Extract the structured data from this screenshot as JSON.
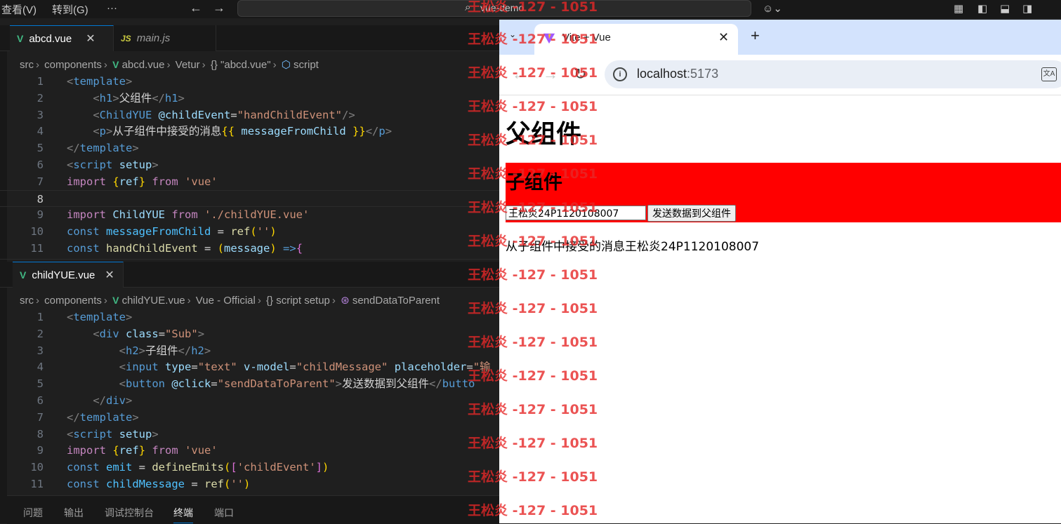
{
  "titlebar": {
    "menu": [
      "查看(V)",
      "转到(G)",
      "···"
    ],
    "command_center": "vue-demo"
  },
  "editor_top": {
    "tabs": [
      {
        "label": "abcd.vue",
        "icon": "vue-icon",
        "active": true
      },
      {
        "label": "main.js",
        "icon": "js-icon",
        "active": false
      }
    ],
    "breadcrumb": [
      "src",
      "components",
      "abcd.vue",
      "Vetur",
      "{} \"abcd.vue\"",
      "script"
    ],
    "current_line": 8,
    "lines": [
      {
        "n": "1",
        "tokens": [
          [
            "pt",
            "<"
          ],
          [
            "tg",
            "template"
          ],
          [
            "pt",
            ">"
          ]
        ]
      },
      {
        "n": "2",
        "tokens": [
          [
            "tx",
            "    "
          ],
          [
            "pt",
            "<"
          ],
          [
            "tg",
            "h1"
          ],
          [
            "pt",
            ">"
          ],
          [
            "tx",
            "父组件"
          ],
          [
            "pt",
            "</"
          ],
          [
            "tg",
            "h1"
          ],
          [
            "pt",
            ">"
          ]
        ]
      },
      {
        "n": "3",
        "tokens": [
          [
            "tx",
            "    "
          ],
          [
            "pt",
            "<"
          ],
          [
            "tg",
            "ChildYUE"
          ],
          [
            "tx",
            " "
          ],
          [
            "at",
            "@childEvent"
          ],
          [
            "tx",
            "="
          ],
          [
            "st",
            "\"handChildEvent\""
          ],
          [
            "pt",
            "/>"
          ]
        ]
      },
      {
        "n": "4",
        "tokens": [
          [
            "tx",
            "    "
          ],
          [
            "pt",
            "<"
          ],
          [
            "tg",
            "p"
          ],
          [
            "pt",
            ">"
          ],
          [
            "tx",
            "从子组件中接受的消息"
          ],
          [
            "br",
            "{{"
          ],
          [
            "tx",
            " "
          ],
          [
            "vr",
            "messageFromChild"
          ],
          [
            "tx",
            " "
          ],
          [
            "br",
            "}}"
          ],
          [
            "pt",
            "</"
          ],
          [
            "tg",
            "p"
          ],
          [
            "pt",
            ">"
          ]
        ]
      },
      {
        "n": "5",
        "tokens": [
          [
            "pt",
            "</"
          ],
          [
            "tg",
            "template"
          ],
          [
            "pt",
            ">"
          ]
        ]
      },
      {
        "n": "6",
        "tokens": [
          [
            "pt",
            "<"
          ],
          [
            "tg",
            "script"
          ],
          [
            "tx",
            " "
          ],
          [
            "at",
            "setup"
          ],
          [
            "pt",
            ">"
          ]
        ]
      },
      {
        "n": "7",
        "tokens": [
          [
            "kw",
            "import"
          ],
          [
            "tx",
            " "
          ],
          [
            "br",
            "{"
          ],
          [
            "vr",
            "ref"
          ],
          [
            "br",
            "}"
          ],
          [
            "tx",
            " "
          ],
          [
            "kw",
            "from"
          ],
          [
            "tx",
            " "
          ],
          [
            "st",
            "'vue'"
          ]
        ]
      },
      {
        "n": "8",
        "tokens": []
      },
      {
        "n": "9",
        "tokens": [
          [
            "kw",
            "import"
          ],
          [
            "tx",
            " "
          ],
          [
            "vr",
            "ChildYUE"
          ],
          [
            "tx",
            " "
          ],
          [
            "kw",
            "from"
          ],
          [
            "tx",
            " "
          ],
          [
            "st",
            "'./childYUE.vue'"
          ]
        ]
      },
      {
        "n": "10",
        "tokens": [
          [
            "kb",
            "const"
          ],
          [
            "tx",
            " "
          ],
          [
            "co",
            "messageFromChild"
          ],
          [
            "tx",
            " = "
          ],
          [
            "fn",
            "ref"
          ],
          [
            "br",
            "("
          ],
          [
            "st",
            "''"
          ],
          [
            "br",
            ")"
          ]
        ]
      },
      {
        "n": "11",
        "tokens": [
          [
            "kb",
            "const"
          ],
          [
            "tx",
            " "
          ],
          [
            "fn",
            "handChildEvent"
          ],
          [
            "tx",
            " = "
          ],
          [
            "br",
            "("
          ],
          [
            "vr",
            "message"
          ],
          [
            "br",
            ")"
          ],
          [
            "tx",
            " "
          ],
          [
            "kb",
            "=>"
          ],
          [
            "br2",
            "{"
          ]
        ]
      }
    ]
  },
  "editor_bottom": {
    "tabs": [
      {
        "label": "childYUE.vue",
        "icon": "vue-icon",
        "active": true
      }
    ],
    "breadcrumb": [
      "src",
      "components",
      "childYUE.vue",
      "Vue - Official",
      "{} script setup",
      "sendDataToParent"
    ],
    "lines": [
      {
        "n": "1",
        "tokens": [
          [
            "pt",
            "<"
          ],
          [
            "tg",
            "template"
          ],
          [
            "pt",
            ">"
          ]
        ]
      },
      {
        "n": "2",
        "tokens": [
          [
            "tx",
            "    "
          ],
          [
            "pt",
            "<"
          ],
          [
            "tg",
            "div"
          ],
          [
            "tx",
            " "
          ],
          [
            "at",
            "class"
          ],
          [
            "tx",
            "="
          ],
          [
            "st",
            "\"Sub\""
          ],
          [
            "pt",
            ">"
          ]
        ]
      },
      {
        "n": "3",
        "tokens": [
          [
            "tx",
            "        "
          ],
          [
            "pt",
            "<"
          ],
          [
            "tg",
            "h2"
          ],
          [
            "pt",
            ">"
          ],
          [
            "tx",
            "子组件"
          ],
          [
            "pt",
            "</"
          ],
          [
            "tg",
            "h2"
          ],
          [
            "pt",
            ">"
          ]
        ]
      },
      {
        "n": "4",
        "tokens": [
          [
            "tx",
            "        "
          ],
          [
            "pt",
            "<"
          ],
          [
            "tg",
            "input"
          ],
          [
            "tx",
            " "
          ],
          [
            "at",
            "type"
          ],
          [
            "tx",
            "="
          ],
          [
            "st",
            "\"text\""
          ],
          [
            "tx",
            " "
          ],
          [
            "at",
            "v-model"
          ],
          [
            "tx",
            "="
          ],
          [
            "st",
            "\"childMessage\""
          ],
          [
            "tx",
            " "
          ],
          [
            "at",
            "placeholder"
          ],
          [
            "tx",
            "="
          ],
          [
            "st",
            "\"输"
          ]
        ]
      },
      {
        "n": "5",
        "tokens": [
          [
            "tx",
            "        "
          ],
          [
            "pt",
            "<"
          ],
          [
            "tg",
            "button"
          ],
          [
            "tx",
            " "
          ],
          [
            "at",
            "@click"
          ],
          [
            "tx",
            "="
          ],
          [
            "st",
            "\"sendDataToParent\""
          ],
          [
            "pt",
            ">"
          ],
          [
            "tx",
            "发送数据到父组件"
          ],
          [
            "pt",
            "</"
          ],
          [
            "tg",
            "butto"
          ]
        ]
      },
      {
        "n": "6",
        "tokens": [
          [
            "tx",
            "    "
          ],
          [
            "pt",
            "</"
          ],
          [
            "tg",
            "div"
          ],
          [
            "pt",
            ">"
          ]
        ]
      },
      {
        "n": "7",
        "tokens": [
          [
            "pt",
            "</"
          ],
          [
            "tg",
            "template"
          ],
          [
            "pt",
            ">"
          ]
        ]
      },
      {
        "n": "8",
        "tokens": [
          [
            "pt",
            "<"
          ],
          [
            "tg",
            "script"
          ],
          [
            "tx",
            " "
          ],
          [
            "at",
            "setup"
          ],
          [
            "pt",
            ">"
          ]
        ]
      },
      {
        "n": "9",
        "tokens": [
          [
            "kw",
            "import"
          ],
          [
            "tx",
            " "
          ],
          [
            "br",
            "{"
          ],
          [
            "vr",
            "ref"
          ],
          [
            "br",
            "}"
          ],
          [
            "tx",
            " "
          ],
          [
            "kw",
            "from"
          ],
          [
            "tx",
            " "
          ],
          [
            "st",
            "'vue'"
          ]
        ]
      },
      {
        "n": "10",
        "tokens": [
          [
            "kb",
            "const"
          ],
          [
            "tx",
            " "
          ],
          [
            "co",
            "emit"
          ],
          [
            "tx",
            " = "
          ],
          [
            "fn",
            "defineEmits"
          ],
          [
            "br",
            "("
          ],
          [
            "br2",
            "["
          ],
          [
            "st",
            "'childEvent'"
          ],
          [
            "br2",
            "]"
          ],
          [
            "br",
            ")"
          ]
        ]
      },
      {
        "n": "11",
        "tokens": [
          [
            "kb",
            "const"
          ],
          [
            "tx",
            " "
          ],
          [
            "co",
            "childMessage"
          ],
          [
            "tx",
            " = "
          ],
          [
            "fn",
            "ref"
          ],
          [
            "br",
            "("
          ],
          [
            "st",
            "''"
          ],
          [
            "br",
            ")"
          ]
        ]
      }
    ]
  },
  "panel": {
    "tabs": [
      "问题",
      "输出",
      "调试控制台",
      "终端",
      "端口"
    ],
    "active": "终端"
  },
  "browser": {
    "tab_title": "Vite + Vue",
    "url_host": "localhost",
    "url_port": ":5173",
    "page": {
      "h1": "父组件",
      "h2": "子组件",
      "input_value": "王松炎24P1120108007",
      "button_label": "发送数据到父组件",
      "message": "从子组件中接受的消息王松炎24P1120108007"
    }
  },
  "watermark": "王松炎 -127 - 1051",
  "colors": {
    "editor_bg": "#1f1f1f",
    "sub_bg": "#ff0000",
    "accent": "#0078d4",
    "watermark": "#e62828"
  }
}
